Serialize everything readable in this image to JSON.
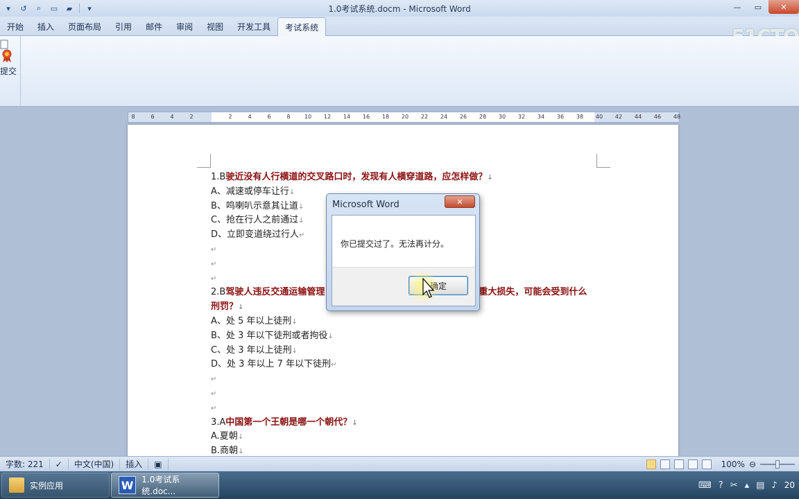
{
  "window": {
    "title": "1.0考试系统.docm - Microsoft Word"
  },
  "ribbon": {
    "tabs": [
      "开始",
      "插入",
      "页面布局",
      "引用",
      "邮件",
      "审阅",
      "视图",
      "开发工具",
      "考试系统"
    ],
    "active_tab": "考试系统",
    "submit_label": "提交",
    "watermark": "51CTO"
  },
  "ruler": {
    "ticks": [
      "8",
      "6",
      "4",
      "2",
      "",
      "2",
      "4",
      "6",
      "8",
      "10",
      "12",
      "14",
      "16",
      "18",
      "20",
      "22",
      "24",
      "26",
      "28",
      "30",
      "32",
      "34",
      "36",
      "38",
      "40",
      "42",
      "44",
      "46",
      "48"
    ]
  },
  "document": {
    "lines": [
      {
        "type": "question",
        "num": "1.B",
        "text": "驶近没有人行横道的交叉路口时，发现有人横穿道路，应怎样做？",
        "mark": "↓"
      },
      {
        "type": "option",
        "text": "A、减速或停车让行",
        "mark": "↓"
      },
      {
        "type": "option",
        "text": "B、鸣喇叭示意其让道",
        "mark": "↓"
      },
      {
        "type": "option",
        "text": "C、抢在行人之前通过",
        "mark": "↓"
      },
      {
        "type": "option",
        "text": "D、立即变道绕过行人",
        "mark": "↵"
      },
      {
        "type": "blank",
        "text": "",
        "mark": "↵"
      },
      {
        "type": "blank",
        "text": "",
        "mark": "↵"
      },
      {
        "type": "blank",
        "text": "",
        "mark": "↵"
      },
      {
        "type": "question",
        "num": "2.B",
        "text": "驾驶人违反交通运输管理",
        "text2": "重大损失，可能会受到什么",
        "mark": ""
      },
      {
        "type": "question",
        "num": "",
        "text": "刑罚？",
        "mark": "↓"
      },
      {
        "type": "option",
        "text": "A、处 5 年以上徒刑",
        "mark": "↓"
      },
      {
        "type": "option",
        "text": "B、处 3 年以下徒刑或者拘役",
        "mark": "↓"
      },
      {
        "type": "option",
        "text": "C、处 3 年以上徒刑",
        "mark": "↓"
      },
      {
        "type": "option",
        "text": "D、处 3 年以上 7 年以下徒刑",
        "mark": "↵"
      },
      {
        "type": "blank",
        "text": "",
        "mark": "↵"
      },
      {
        "type": "blank",
        "text": "",
        "mark": "↵"
      },
      {
        "type": "blank",
        "text": "",
        "mark": "↵"
      },
      {
        "type": "question",
        "num": "3.A",
        "text": "中国第一个王朝是哪一个朝代？",
        "mark": "↓"
      },
      {
        "type": "option",
        "text": "A.夏朝",
        "mark": "↓"
      },
      {
        "type": "option",
        "text": "B.商朝",
        "mark": "↓"
      }
    ]
  },
  "dialog": {
    "title": "Microsoft Word",
    "message": "你已提交过了。无法再计分。",
    "ok_label": "确定",
    "close_glyph": "✕"
  },
  "statusbar": {
    "word_count": "字数: 221",
    "language": "中文(中国)",
    "mode": "插入",
    "zoom": "100%"
  },
  "taskbar": {
    "items": [
      {
        "label": "实例应用",
        "icon": "folder-icon"
      },
      {
        "label": "1.0考试系统.doc...",
        "icon": "word-icon"
      }
    ],
    "clock_fragment": "20"
  }
}
